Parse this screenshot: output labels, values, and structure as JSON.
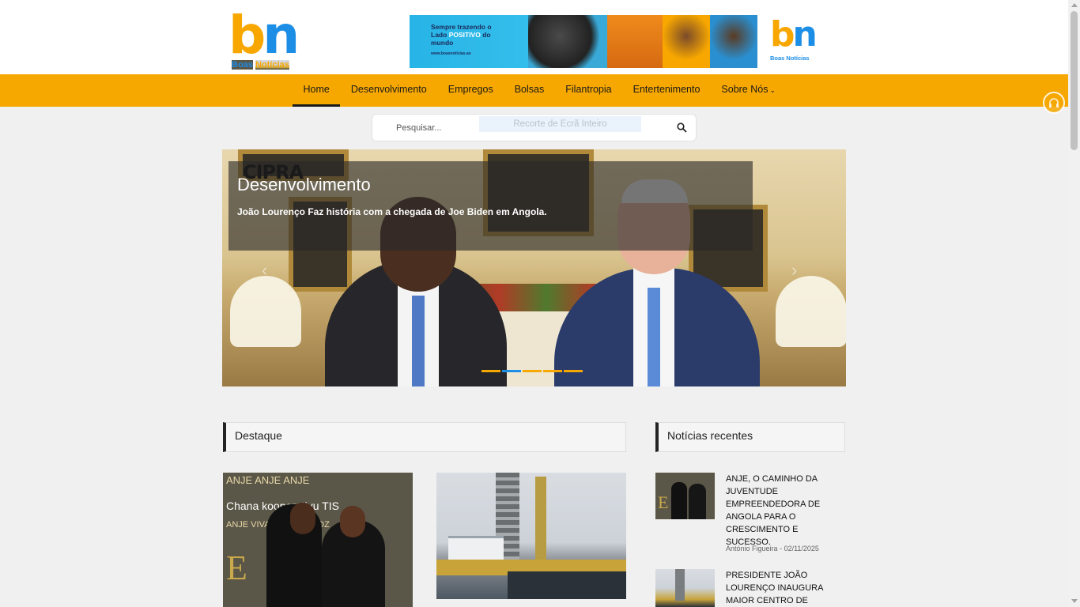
{
  "header": {
    "logo": {
      "letter_b": "b",
      "letter_n": "n",
      "tag_part1": "Boas",
      "tag_part2": "Notícias"
    },
    "banner": {
      "text_line1": "Sempre trazendo o",
      "text_line2": "Lado",
      "text_highlight": "POSITIVO",
      "text_line3": "do",
      "text_line4": "mundo",
      "url": "www.boasnoticias.ao",
      "logo_letters": "bn",
      "logo_tag": "Boas Notícias"
    }
  },
  "nav": {
    "items": [
      {
        "label": "Home"
      },
      {
        "label": "Desenvolvimento"
      },
      {
        "label": "Empregos"
      },
      {
        "label": "Bolsas"
      },
      {
        "label": "Filantropia"
      },
      {
        "label": "Entertenimento"
      },
      {
        "label": "Sobre Nós"
      }
    ],
    "caret": "⌄"
  },
  "search": {
    "placeholder": "Pesquisar...",
    "ghost_text": "Recorte de Ecrã Inteiro",
    "icon": "search-icon"
  },
  "slider": {
    "brand": "CIPRA",
    "category": "Desenvolvimento",
    "headline": "João Lourenço Faz história com a chegada de Joe Biden em Angola.",
    "prev": "‹",
    "next": "›",
    "dots_total": 5,
    "active_dot": 1
  },
  "destaque": {
    "title": "Destaque",
    "card1_rows": [
      "ANJE  ANJE  ANJE",
      "Chana  kooperativu  TIS",
      "ANJE  VIVA  UNITEL  MADZ"
    ],
    "card1_big": "E"
  },
  "recentes": {
    "title": "Notícias recentes",
    "items": [
      {
        "title": "ANJE, O CAMINHO DA JUVENTUDE EMPREENDEDORA DE ANGOLA PARA O CRESCIMENTO E SUCESSO.",
        "author": "António Figueira",
        "date": "02/11/2025",
        "thumb_letter": "E"
      },
      {
        "title": "PRESIDENTE JOÃO LOURENÇO INAUGURA MAIOR CENTRO DE"
      }
    ]
  },
  "colors": {
    "accent": "#f7a800",
    "blue": "#1c8ee6"
  }
}
